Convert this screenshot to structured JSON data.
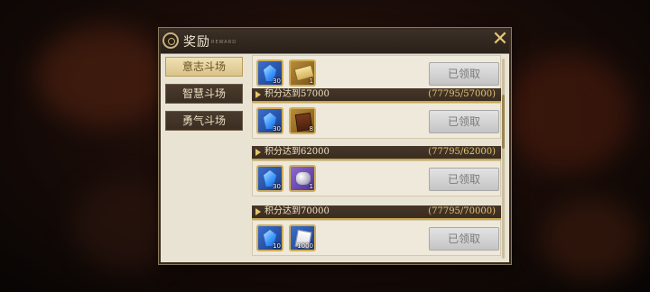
{
  "dialog": {
    "title": "奖励",
    "subtitle": "REWARD",
    "close_icon": "close-icon"
  },
  "sidebar": {
    "tabs": [
      {
        "label": "意志斗场",
        "active": true
      },
      {
        "label": "智慧斗场",
        "active": false
      },
      {
        "label": "勇气斗场",
        "active": false
      }
    ]
  },
  "rewards": [
    {
      "title": "",
      "progress": "",
      "items": [
        {
          "icon": "blue-crystal-icon",
          "qty": "30"
        },
        {
          "icon": "ticket-icon",
          "qty": "1"
        }
      ],
      "button": "已领取"
    },
    {
      "title": "积分达到57000",
      "progress": "(77795/57000)",
      "items": [
        {
          "icon": "blue-crystal-icon",
          "qty": "30"
        },
        {
          "icon": "book-icon",
          "qty": "8"
        }
      ],
      "button": "已领取"
    },
    {
      "title": "积分达到62000",
      "progress": "(77795/62000)",
      "items": [
        {
          "icon": "blue-crystal-icon",
          "qty": "30"
        },
        {
          "icon": "silver-ore-icon",
          "qty": "1"
        }
      ],
      "button": "已领取"
    },
    {
      "title": "积分达到70000",
      "progress": "(77795/70000)",
      "items": [
        {
          "icon": "blue-crystal-icon",
          "qty": "10"
        },
        {
          "icon": "paper-icon",
          "qty": "1000"
        }
      ],
      "button": "已领取"
    }
  ]
}
